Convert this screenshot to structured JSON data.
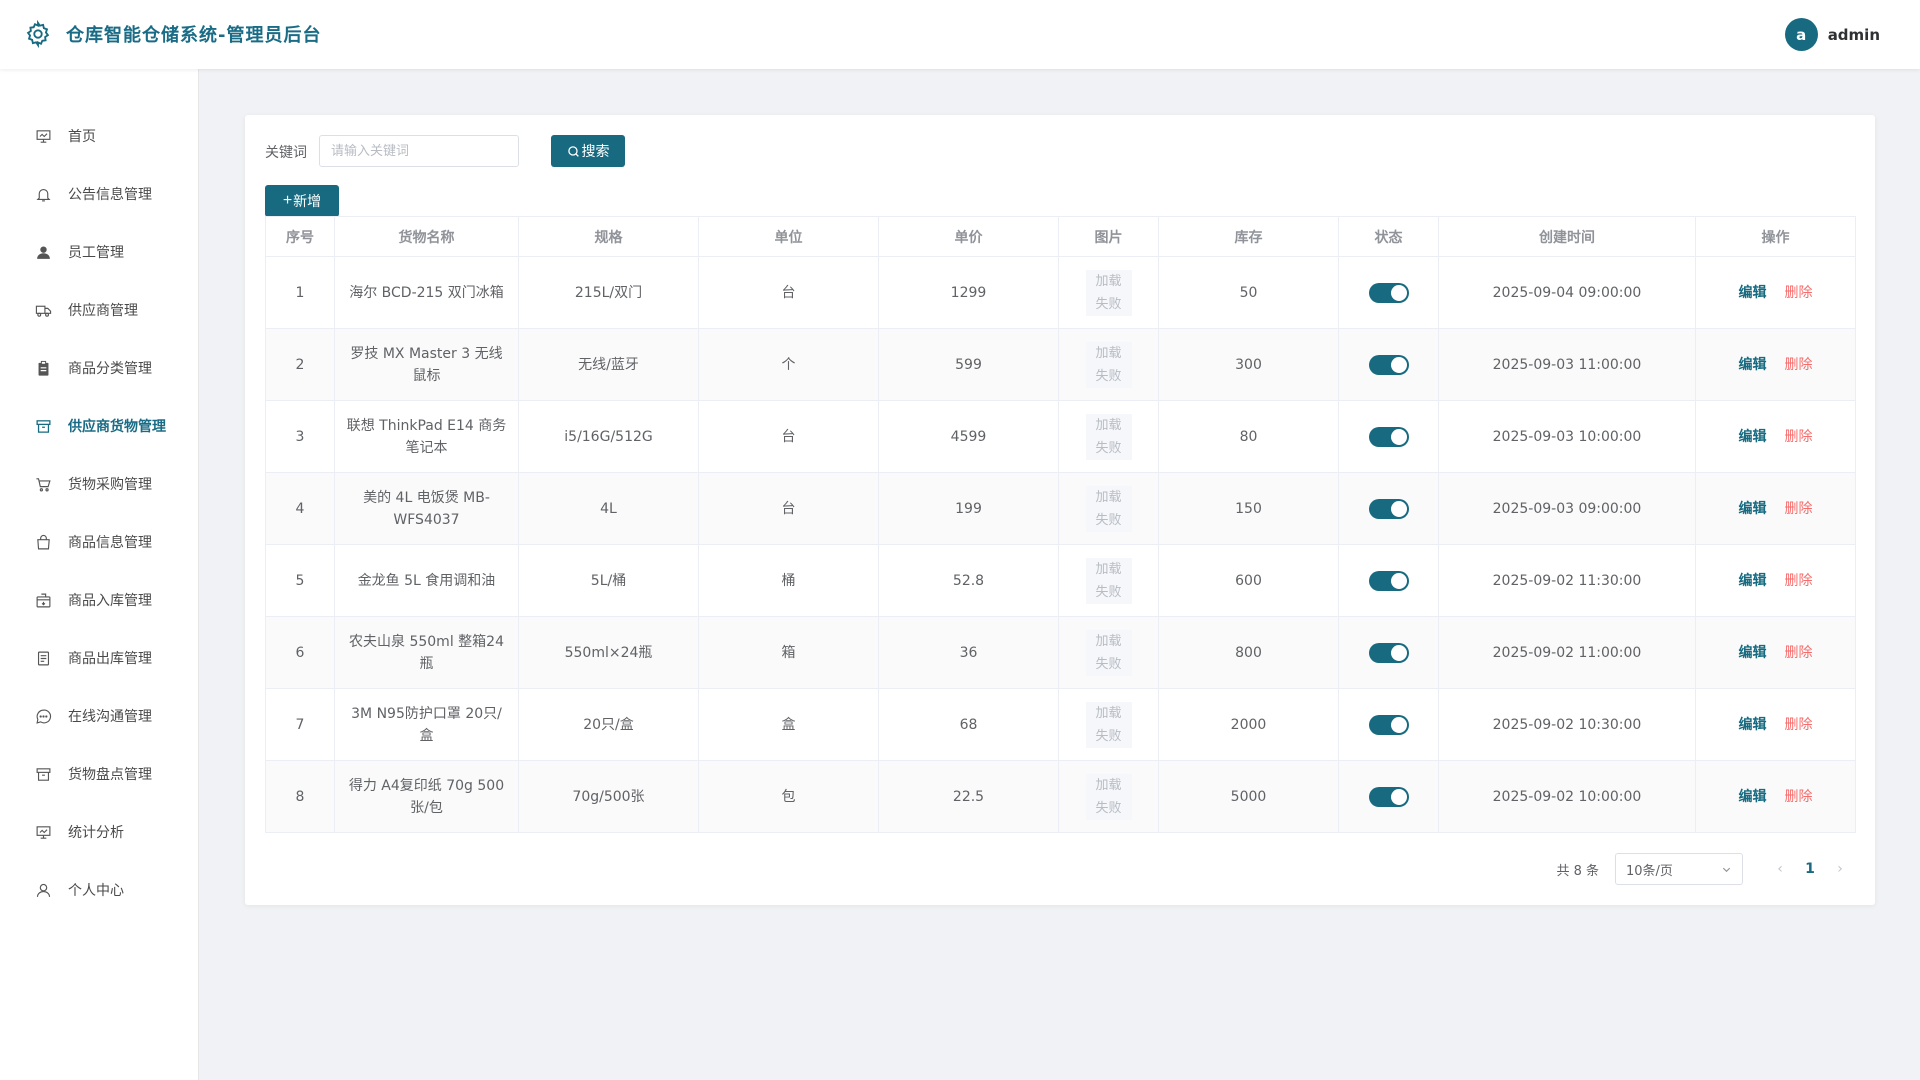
{
  "header": {
    "title": "仓库智能仓储系统-管理员后台",
    "avatar_letter": "a",
    "username": "admin"
  },
  "sidebar": {
    "items": [
      {
        "label": "首页",
        "icon": "home-icon"
      },
      {
        "label": "公告信息管理",
        "icon": "bell-icon"
      },
      {
        "label": "员工管理",
        "icon": "user-icon"
      },
      {
        "label": "供应商管理",
        "icon": "truck-icon"
      },
      {
        "label": "商品分类管理",
        "icon": "clipboard-icon"
      },
      {
        "label": "供应商货物管理",
        "icon": "box-icon",
        "active": true
      },
      {
        "label": "货物采购管理",
        "icon": "cart-icon"
      },
      {
        "label": "商品信息管理",
        "icon": "bag-icon"
      },
      {
        "label": "商品入库管理",
        "icon": "box-in-icon"
      },
      {
        "label": "商品出库管理",
        "icon": "document-icon"
      },
      {
        "label": "在线沟通管理",
        "icon": "chat-icon"
      },
      {
        "label": "货物盘点管理",
        "icon": "box-icon"
      },
      {
        "label": "统计分析",
        "icon": "chart-icon"
      },
      {
        "label": "个人中心",
        "icon": "person-icon"
      }
    ]
  },
  "search": {
    "label": "关键词",
    "placeholder": "请输入关键词",
    "value": "",
    "button_label": "搜索",
    "add_label": "新增"
  },
  "table": {
    "columns": [
      "序号",
      "货物名称",
      "规格",
      "单位",
      "单价",
      "图片",
      "库存",
      "状态",
      "创建时间",
      "操作"
    ],
    "image_fail_text": "加载失败",
    "edit_label": "编辑",
    "delete_label": "删除",
    "rows": [
      {
        "index": "1",
        "name": "海尔 BCD-215 双门冰箱",
        "spec": "215L/双门",
        "unit": "台",
        "price": "1299",
        "stock": "50",
        "enabled": true,
        "created": "2025-09-04 09:00:00"
      },
      {
        "index": "2",
        "name": "罗技 MX Master 3 无线鼠标",
        "spec": "无线/蓝牙",
        "unit": "个",
        "price": "599",
        "stock": "300",
        "enabled": true,
        "created": "2025-09-03 11:00:00"
      },
      {
        "index": "3",
        "name": "联想 ThinkPad E14 商务笔记本",
        "spec": "i5/16G/512G",
        "unit": "台",
        "price": "4599",
        "stock": "80",
        "enabled": true,
        "created": "2025-09-03 10:00:00"
      },
      {
        "index": "4",
        "name": "美的 4L 电饭煲 MB-WFS4037",
        "spec": "4L",
        "unit": "台",
        "price": "199",
        "stock": "150",
        "enabled": true,
        "created": "2025-09-03 09:00:00"
      },
      {
        "index": "5",
        "name": "金龙鱼 5L 食用调和油",
        "spec": "5L/桶",
        "unit": "桶",
        "price": "52.8",
        "stock": "600",
        "enabled": true,
        "created": "2025-09-02 11:30:00"
      },
      {
        "index": "6",
        "name": "农夫山泉 550ml 整箱24瓶",
        "spec": "550ml×24瓶",
        "unit": "箱",
        "price": "36",
        "stock": "800",
        "enabled": true,
        "created": "2025-09-02 11:00:00"
      },
      {
        "index": "7",
        "name": "3M N95防护口罩 20只/盒",
        "spec": "20只/盒",
        "unit": "盒",
        "price": "68",
        "stock": "2000",
        "enabled": true,
        "created": "2025-09-02 10:30:00"
      },
      {
        "index": "8",
        "name": "得力 A4复印纸 70g 500张/包",
        "spec": "70g/500张",
        "unit": "包",
        "price": "22.5",
        "stock": "5000",
        "enabled": true,
        "created": "2025-09-02 10:00:00"
      }
    ]
  },
  "pagination": {
    "total_text": "共 8 条",
    "page_size": "10条/页",
    "current_page": "1",
    "prev": "‹",
    "next": "›"
  },
  "colors": {
    "accent": "#176a80",
    "danger": "#f56c6c"
  }
}
